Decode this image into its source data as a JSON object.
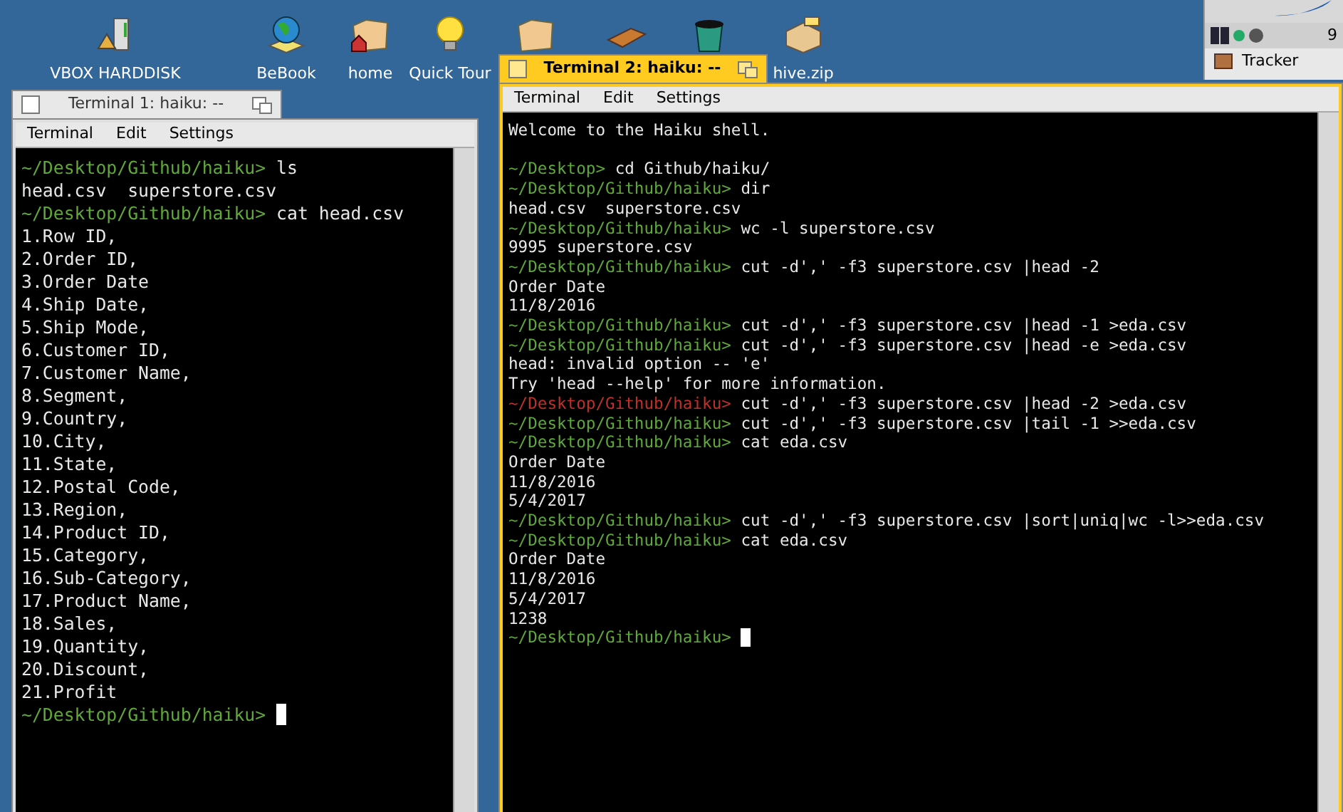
{
  "desktop_icons": [
    {
      "kind": "drive",
      "label": "VBOX HARDDISK"
    },
    {
      "kind": "globe",
      "label": "BeBook"
    },
    {
      "kind": "home",
      "label": "home"
    },
    {
      "kind": "bulb",
      "label": "Quick Tour"
    },
    {
      "kind": "folder"
    },
    {
      "kind": "book"
    },
    {
      "kind": "trash"
    },
    {
      "kind": "archive",
      "label": "hive.zip"
    }
  ],
  "deskbar": {
    "clock": "9",
    "tracker": "Tracker"
  },
  "windows": [
    {
      "title": "Terminal 1: haiku: --",
      "focused": false,
      "menu": [
        "Terminal",
        "Edit",
        "Settings"
      ],
      "lines": [
        {
          "kind": "prompt",
          "prompt": "~/Desktop/Github/haiku>",
          "text": "ls",
          "color": "#5fa83a"
        },
        {
          "kind": "output",
          "text": "head.csv  superstore.csv"
        },
        {
          "kind": "prompt",
          "prompt": "~/Desktop/Github/haiku>",
          "text": "cat head.csv",
          "color": "#5fa83a"
        },
        {
          "kind": "output",
          "text": "1.Row ID,"
        },
        {
          "kind": "output",
          "text": "2.Order ID,"
        },
        {
          "kind": "output",
          "text": "3.Order Date"
        },
        {
          "kind": "output",
          "text": "4.Ship Date,"
        },
        {
          "kind": "output",
          "text": "5.Ship Mode,"
        },
        {
          "kind": "output",
          "text": "6.Customer ID,"
        },
        {
          "kind": "output",
          "text": "7.Customer Name,"
        },
        {
          "kind": "output",
          "text": "8.Segment,"
        },
        {
          "kind": "output",
          "text": "9.Country,"
        },
        {
          "kind": "output",
          "text": "10.City,"
        },
        {
          "kind": "output",
          "text": "11.State,"
        },
        {
          "kind": "output",
          "text": "12.Postal Code,"
        },
        {
          "kind": "output",
          "text": "13.Region,"
        },
        {
          "kind": "output",
          "text": "14.Product ID,"
        },
        {
          "kind": "output",
          "text": "15.Category,"
        },
        {
          "kind": "output",
          "text": "16.Sub-Category,"
        },
        {
          "kind": "output",
          "text": "17.Product Name,"
        },
        {
          "kind": "output",
          "text": "18.Sales,"
        },
        {
          "kind": "output",
          "text": "19.Quantity,"
        },
        {
          "kind": "output",
          "text": "20.Discount,"
        },
        {
          "kind": "output",
          "text": "21.Profit"
        },
        {
          "kind": "prompt",
          "prompt": "~/Desktop/Github/haiku>",
          "color": "#5fa83a",
          "cursor": true
        }
      ]
    },
    {
      "title": "Terminal 2: haiku: --",
      "focused": true,
      "menu": [
        "Terminal",
        "Edit",
        "Settings"
      ],
      "lines": [
        {
          "kind": "output",
          "text": "Welcome to the Haiku shell."
        },
        {
          "kind": "blank"
        },
        {
          "kind": "prompt",
          "prompt": "~/Desktop>",
          "text": "cd Github/haiku/",
          "color": "#5fa83a"
        },
        {
          "kind": "prompt",
          "prompt": "~/Desktop/Github/haiku>",
          "text": "dir",
          "color": "#5fa83a"
        },
        {
          "kind": "output",
          "text": "head.csv  superstore.csv"
        },
        {
          "kind": "prompt",
          "prompt": "~/Desktop/Github/haiku>",
          "text": "wc -l superstore.csv",
          "color": "#5fa83a"
        },
        {
          "kind": "output",
          "text": "9995 superstore.csv"
        },
        {
          "kind": "prompt",
          "prompt": "~/Desktop/Github/haiku>",
          "text": "cut -d',' -f3 superstore.csv |head -2",
          "color": "#5fa83a"
        },
        {
          "kind": "output",
          "text": "Order Date"
        },
        {
          "kind": "output",
          "text": "11/8/2016"
        },
        {
          "kind": "prompt",
          "prompt": "~/Desktop/Github/haiku>",
          "text": "cut -d',' -f3 superstore.csv |head -1 >eda.csv",
          "color": "#5fa83a"
        },
        {
          "kind": "prompt",
          "prompt": "~/Desktop/Github/haiku>",
          "text": "cut -d',' -f3 superstore.csv |head -e >eda.csv",
          "color": "#5fa83a"
        },
        {
          "kind": "output",
          "text": "head: invalid option -- 'e'"
        },
        {
          "kind": "output",
          "text": "Try 'head --help' for more information."
        },
        {
          "kind": "prompt",
          "prompt": "~/Desktop/Github/haiku>",
          "text": "cut -d',' -f3 superstore.csv |head -2 >eda.csv",
          "color": "#c0302a"
        },
        {
          "kind": "prompt",
          "prompt": "~/Desktop/Github/haiku>",
          "text": "cut -d',' -f3 superstore.csv |tail -1 >>eda.csv",
          "color": "#5fa83a"
        },
        {
          "kind": "prompt",
          "prompt": "~/Desktop/Github/haiku>",
          "text": "cat eda.csv",
          "color": "#5fa83a"
        },
        {
          "kind": "output",
          "text": "Order Date"
        },
        {
          "kind": "output",
          "text": "11/8/2016"
        },
        {
          "kind": "output",
          "text": "5/4/2017"
        },
        {
          "kind": "prompt",
          "prompt": "~/Desktop/Github/haiku>",
          "text": "cut -d',' -f3 superstore.csv |sort|uniq|wc -l>>eda.csv",
          "color": "#5fa83a"
        },
        {
          "kind": "prompt",
          "prompt": "~/Desktop/Github/haiku>",
          "text": "cat eda.csv",
          "color": "#5fa83a"
        },
        {
          "kind": "output",
          "text": "Order Date"
        },
        {
          "kind": "output",
          "text": "11/8/2016"
        },
        {
          "kind": "output",
          "text": "5/4/2017"
        },
        {
          "kind": "output",
          "text": "1238"
        },
        {
          "kind": "prompt",
          "prompt": "~/Desktop/Github/haiku>",
          "color": "#5fa83a",
          "cursor": true
        }
      ]
    }
  ]
}
